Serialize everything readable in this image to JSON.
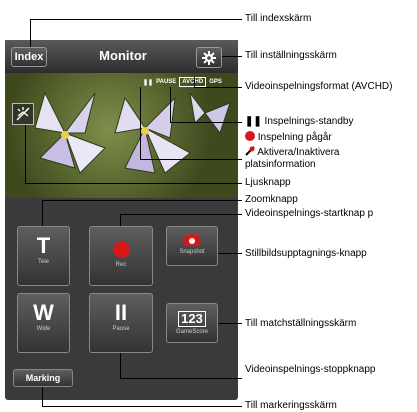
{
  "phone": {
    "index_label": "Index",
    "title": "Monitor",
    "status_pause": "PAUSE",
    "status_format": "AVCHD",
    "status_extra": "GPS"
  },
  "controls": {
    "tele_glyph": "T",
    "tele_label": "Tele",
    "wide_glyph": "W",
    "wide_label": "Wide",
    "rec_label": "Rec",
    "pause_glyph": "II",
    "pause_label": "Pause",
    "snapshot_label": "Snapshot",
    "gamescore_glyph": "123",
    "gamescore_label": "GameScore",
    "marking_label": "Marking"
  },
  "callouts": {
    "index": "Till indexskärm",
    "settings": "Till inställningsskärm",
    "format": "Videoinspelningsformat (AVCHD)",
    "standby": "Inspelnings-standby",
    "recording": "Inspelning pågår",
    "gps": "Aktivera/Inaktivera platsinformation",
    "light": "Ljusknapp",
    "zoom": "Zoomknapp",
    "start": "Videoinspelnings-startknap p",
    "snapshot": "Stillbildsupptagnings-knapp",
    "match": "Till matchställningsskärm",
    "stop": "Videoinspelnings-stoppknapp",
    "marking": "Till markeringsskärm"
  },
  "colors": {
    "rec_red": "#d81818",
    "panel": "#3a3a3a"
  }
}
